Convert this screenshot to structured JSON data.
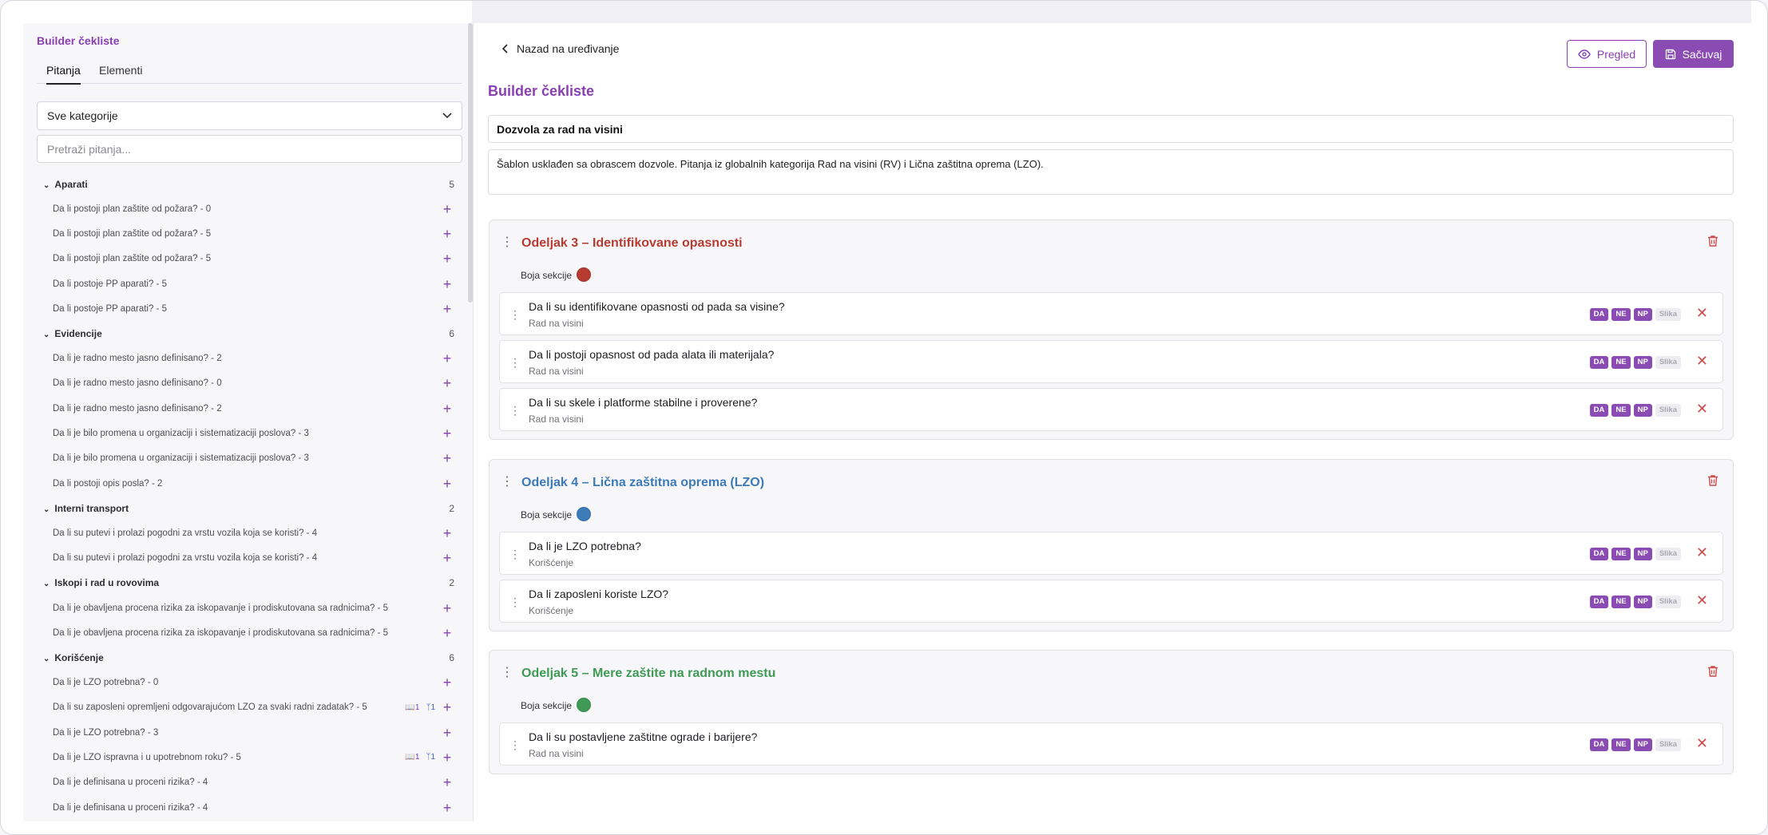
{
  "sidebar": {
    "title": "Builder čekliste",
    "tabs": [
      "Pitanja",
      "Elementi"
    ],
    "category_select": "Sve kategorije",
    "search_placeholder": "Pretraži pitanja...",
    "categories": [
      {
        "name": "Aparati",
        "count": "5",
        "questions": [
          {
            "text": "Da li postoji plan zaštite od požara? - 0"
          },
          {
            "text": "Da li postoji plan zaštite od požara? - 5"
          },
          {
            "text": "Da li postoji plan zaštite od požara? - 5"
          },
          {
            "text": "Da li postoje PP aparati? - 5"
          },
          {
            "text": "Da li postoje PP aparati? - 5"
          }
        ]
      },
      {
        "name": "Evidencije",
        "count": "6",
        "questions": [
          {
            "text": "Da li je radno mesto jasno definisano? - 2"
          },
          {
            "text": "Da li je radno mesto jasno definisano? - 0"
          },
          {
            "text": "Da li je radno mesto jasno definisano? - 2"
          },
          {
            "text": "Da li je bilo promena u organizaciji i sistematizaciji poslova? - 3"
          },
          {
            "text": "Da li je bilo promena u organizaciji i sistematizaciji poslova? - 3"
          },
          {
            "text": "Da li postoji opis posla? - 2"
          }
        ]
      },
      {
        "name": "Interni transport",
        "count": "2",
        "questions": [
          {
            "text": "Da li su putevi i prolazi pogodni za vrstu vozila koja se koristi? - 4"
          },
          {
            "text": "Da li su putevi i prolazi pogodni za vrstu vozila koja se koristi? - 4"
          }
        ]
      },
      {
        "name": "Iskopi i rad u rovovima",
        "count": "2",
        "questions": [
          {
            "text": "Da li je obavljena procena rizika za iskopavanje i prodiskutovana sa radnicima? - 5"
          },
          {
            "text": "Da li je obavljena procena rizika za iskopavanje i prodiskutovana sa radnicima? - 5"
          }
        ]
      },
      {
        "name": "Korišćenje",
        "count": "6",
        "questions": [
          {
            "text": "Da li je LZO potrebna? - 0"
          },
          {
            "text": "Da li su zaposleni opremljeni odgovarajućom LZO za svaki radni zadatak? - 5",
            "badge1": "1",
            "badge2": "1"
          },
          {
            "text": "Da li je LZO potrebna? - 3"
          },
          {
            "text": "Da li je LZO ispravna i u upotrebnom roku? - 5",
            "badge1": "1",
            "badge2": "1"
          },
          {
            "text": "Da li je definisana u proceni rizika? - 4"
          },
          {
            "text": "Da li je definisana u proceni rizika? - 4"
          }
        ]
      }
    ]
  },
  "main": {
    "back_label": "Nazad na uređivanje",
    "preview_label": "Pregled",
    "save_label": "Sačuvaj",
    "title": "Builder čekliste",
    "checklist_name": "Dozvola za rad na visini",
    "checklist_description": "Šablon usklađen sa obrascem dozvole. Pitanja iz globalnih kategorija Rad na visini (RV) i Lična zaštitna oprema (LZO).",
    "section_color_label": "Boja sekcije",
    "answer_tags": [
      "DA",
      "NE",
      "NP"
    ],
    "image_tag": "Slika",
    "sections": [
      {
        "title": "Odeljak 3 – Identifikovane opasnosti",
        "color": "#b83b32",
        "questions": [
          {
            "text": "Da li su identifikovane opasnosti od pada sa visine?",
            "category": "Rad na visini"
          },
          {
            "text": "Da li postoji opasnost od pada alata ili materijala?",
            "category": "Rad na visini"
          },
          {
            "text": "Da li su skele i platforme stabilne i proverene?",
            "category": "Rad na visini"
          }
        ]
      },
      {
        "title": "Odeljak 4 – Lična zaštitna oprema (LZO)",
        "color": "#3d7ab8",
        "questions": [
          {
            "text": "Da li je LZO potrebna?",
            "category": "Korišćenje"
          },
          {
            "text": "Da li zaposleni koriste LZO?",
            "category": "Korišćenje"
          }
        ]
      },
      {
        "title": "Odeljak 5 – Mere zaštite na radnom mestu",
        "color": "#3f9a55",
        "questions": [
          {
            "text": "Da li su postavljene zaštitne ograde i barijere?",
            "category": "Rad na visini"
          }
        ]
      }
    ]
  }
}
